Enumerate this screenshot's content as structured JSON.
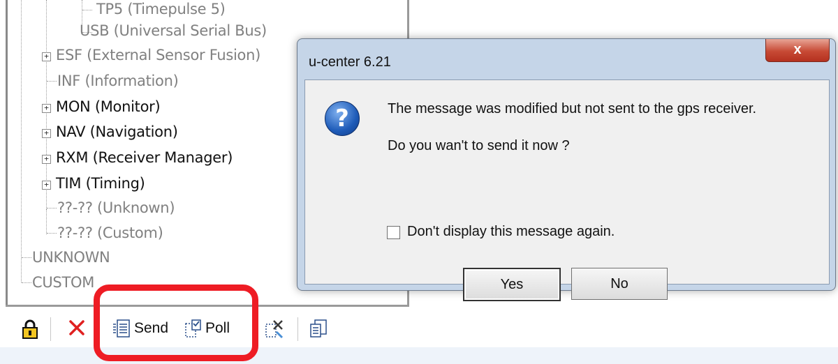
{
  "tree": {
    "items": [
      {
        "label": "TP5 (Timepulse 5)",
        "style": "muted"
      },
      {
        "label": "USB (Universal Serial Bus)",
        "style": "muted"
      },
      {
        "label": "ESF (External Sensor Fusion)",
        "style": "muted"
      },
      {
        "label": "INF (Information)",
        "style": "muted"
      },
      {
        "label": "MON (Monitor)",
        "style": "bold"
      },
      {
        "label": "NAV (Navigation)",
        "style": "bold"
      },
      {
        "label": "RXM (Receiver Manager)",
        "style": "bold"
      },
      {
        "label": "TIM (Timing)",
        "style": "bold"
      },
      {
        "label": "??-?? (Unknown)",
        "style": "muted"
      },
      {
        "label": "??-?? (Custom)",
        "style": "muted"
      },
      {
        "label": "UNKNOWN",
        "style": "muted"
      },
      {
        "label": "CUSTOM",
        "style": "muted"
      }
    ],
    "expander_symbol": "+"
  },
  "toolbar": {
    "send_label": "Send",
    "poll_label": "Poll",
    "lock_icon": "lock-icon",
    "delete_icon": "delete-x-icon"
  },
  "dialog": {
    "title": "u-center 6.21",
    "close_symbol": "x",
    "message": "The message was modified but not sent to the gps receiver.",
    "question": "Do you wan't to send it now ?",
    "checkbox_label": "Don't display this message again.",
    "checkbox_checked": false,
    "yes_label": "Yes",
    "no_label": "No",
    "icon_glyph": "?"
  },
  "colors": {
    "highlight": "#ee1c24",
    "dialog_frame": "#c5d5e8",
    "close_button": "#c74a35"
  }
}
